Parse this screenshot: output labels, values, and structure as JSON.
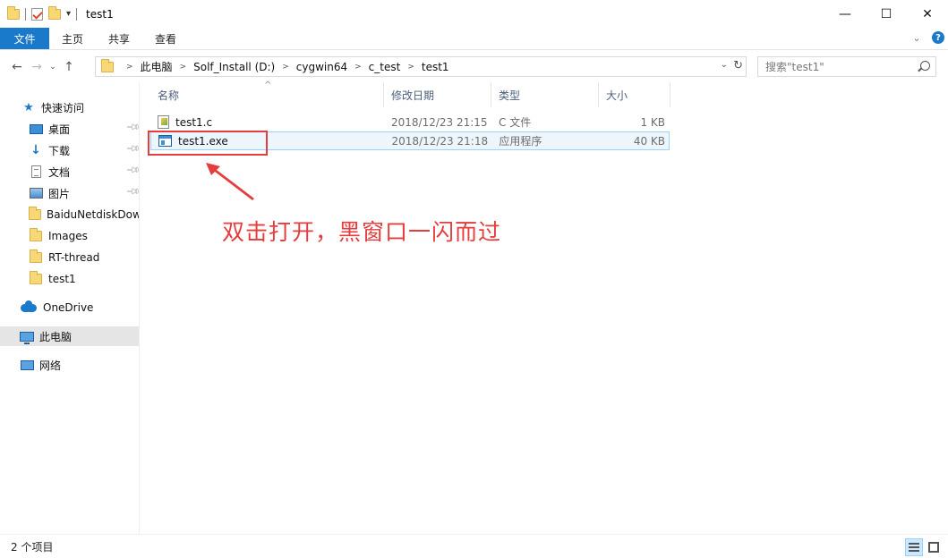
{
  "window": {
    "title": "test1"
  },
  "ribbon": {
    "tabs": [
      "文件",
      "主页",
      "共享",
      "查看"
    ]
  },
  "address": {
    "crumbs": [
      "此电脑",
      "Solf_Install (D:)",
      "cygwin64",
      "c_test",
      "test1"
    ]
  },
  "search": {
    "placeholder": "搜索\"test1\""
  },
  "nav": {
    "quick_access": "快速访问",
    "items": [
      {
        "label": "桌面",
        "icon": "desktop-icon",
        "pinned": true
      },
      {
        "label": "下载",
        "icon": "download-icon",
        "pinned": true
      },
      {
        "label": "文档",
        "icon": "document-icon",
        "pinned": true
      },
      {
        "label": "图片",
        "icon": "picture-icon",
        "pinned": true
      },
      {
        "label": "BaiduNetdiskDow",
        "icon": "folder-icon",
        "pinned": false
      },
      {
        "label": "Images",
        "icon": "folder-icon",
        "pinned": false
      },
      {
        "label": "RT-thread",
        "icon": "folder-icon",
        "pinned": false
      },
      {
        "label": "test1",
        "icon": "folder-icon",
        "pinned": false
      }
    ],
    "onedrive": "OneDrive",
    "this_pc": "此电脑",
    "network": "网络"
  },
  "columns": {
    "name": "名称",
    "date": "修改日期",
    "type": "类型",
    "size": "大小"
  },
  "files": [
    {
      "name": "test1.c",
      "date": "2018/12/23 21:15",
      "type": "C 文件",
      "size": "1 KB",
      "icon": "c-source-file-icon"
    },
    {
      "name": "test1.exe",
      "date": "2018/12/23 21:18",
      "type": "应用程序",
      "size": "40 KB",
      "icon": "exe-file-icon"
    }
  ],
  "annotation": {
    "text": "双击打开，黑窗口一闪而过",
    "color": "#e53d3d"
  },
  "status": {
    "count": "2 个项目"
  },
  "colors": {
    "accent": "#1979ca",
    "selection": "#cce8ff"
  }
}
